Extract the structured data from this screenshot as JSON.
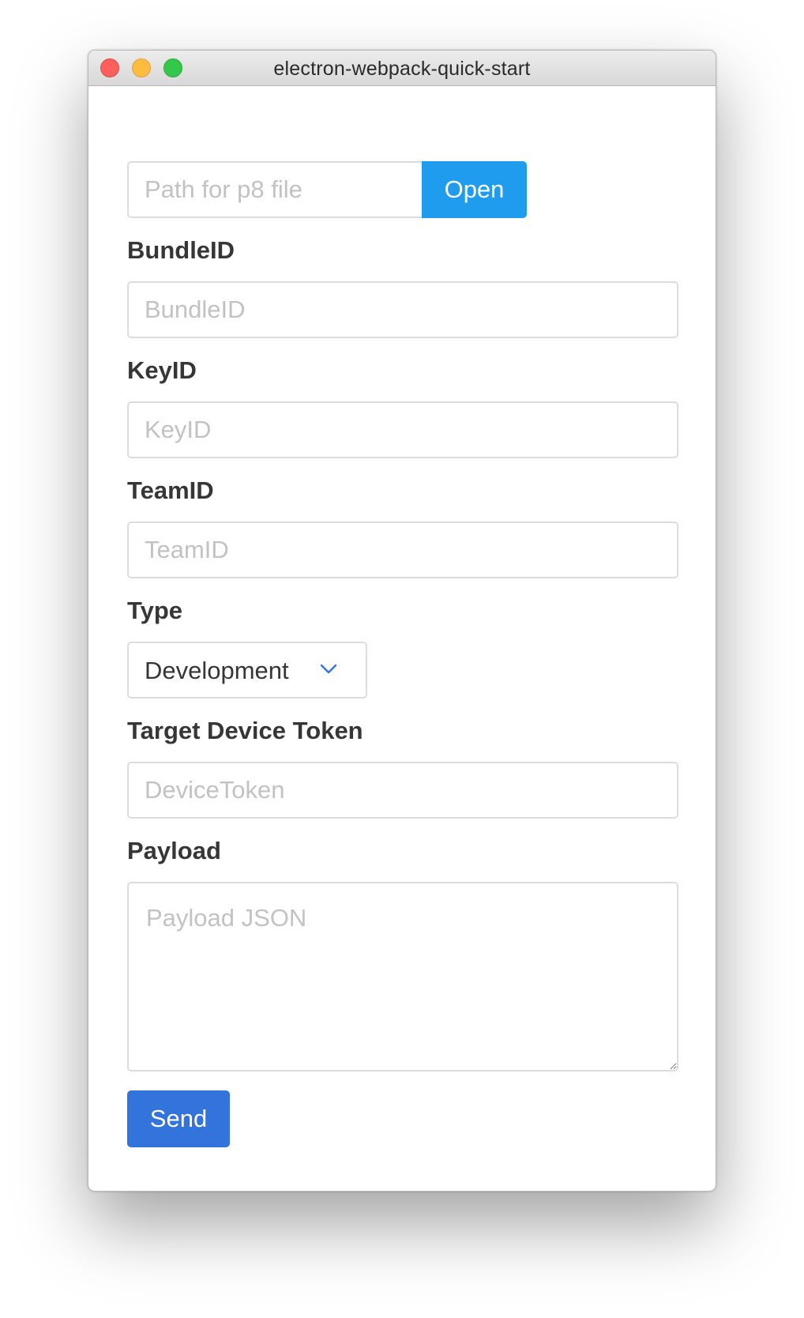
{
  "window": {
    "title": "electron-webpack-quick-start"
  },
  "file": {
    "path_placeholder": "Path for p8 file",
    "path_value": "",
    "open_label": "Open"
  },
  "bundle": {
    "label": "BundleID",
    "placeholder": "BundleID",
    "value": ""
  },
  "key": {
    "label": "KeyID",
    "placeholder": "KeyID",
    "value": ""
  },
  "team": {
    "label": "TeamID",
    "placeholder": "TeamID",
    "value": ""
  },
  "type": {
    "label": "Type",
    "selected": "Development",
    "chevron_icon": "chevron-down-icon",
    "chevron_color": "#3273dc"
  },
  "device": {
    "label": "Target Device Token",
    "placeholder": "DeviceToken",
    "value": ""
  },
  "payload": {
    "label": "Payload",
    "placeholder": "Payload JSON",
    "value": ""
  },
  "send": {
    "label": "Send",
    "color": "#3273dc"
  },
  "colors": {
    "open_button": "#209cee",
    "traffic_close": "#fc605c",
    "traffic_minimize": "#fdbc40",
    "traffic_maximize": "#34c84a"
  }
}
